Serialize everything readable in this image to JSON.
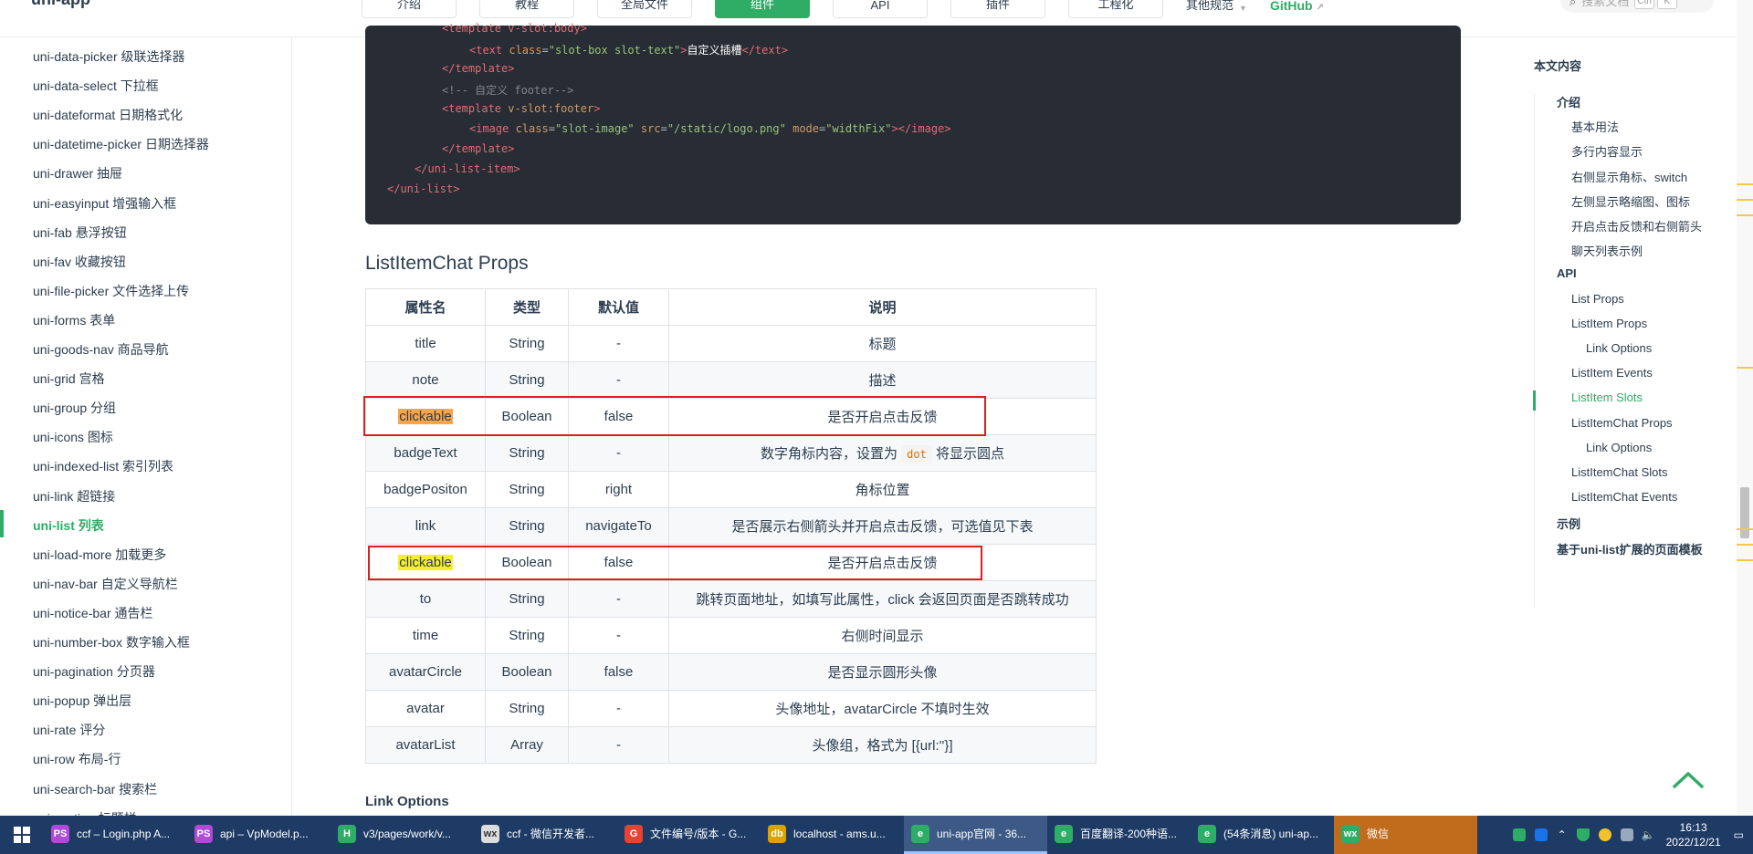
{
  "header": {
    "logo": "uni-app",
    "nav": [
      "介绍",
      "教程",
      "全局文件",
      "组件",
      "API",
      "插件",
      "工程化"
    ],
    "nav_active": "组件",
    "nav_more": "其他规范",
    "github": "GitHub",
    "search_placeholder": "搜索文档",
    "search_keys": [
      "Ctrl",
      "K"
    ]
  },
  "sidebar": {
    "items": [
      "uni-data-picker 级联选择器",
      "uni-data-select 下拉框",
      "uni-dateformat 日期格式化",
      "uni-datetime-picker 日期选择器",
      "uni-drawer 抽屉",
      "uni-easyinput 增强输入框",
      "uni-fab 悬浮按钮",
      "uni-fav 收藏按钮",
      "uni-file-picker 文件选择上传",
      "uni-forms 表单",
      "uni-goods-nav 商品导航",
      "uni-grid 宫格",
      "uni-group 分组",
      "uni-icons 图标",
      "uni-indexed-list 索引列表",
      "uni-link 超链接",
      "uni-list 列表",
      "uni-load-more 加载更多",
      "uni-nav-bar 自定义导航栏",
      "uni-notice-bar 通告栏",
      "uni-number-box 数字输入框",
      "uni-pagination 分页器",
      "uni-popup 弹出层",
      "uni-rate 评分",
      "uni-row 布局-行",
      "uni-search-bar 搜索栏",
      "uni-section 标题栏"
    ],
    "active": "uni-list 列表"
  },
  "code": {
    "line0": "<template v-slot:body>",
    "line1_open": "<text",
    "line1_attr": "class",
    "line1_val": "\"slot-box slot-text\"",
    "line1_text": "自定义插槽",
    "line1_close": "</text>",
    "line2": "</template>",
    "line3": "<!-- 自定义 footer-->",
    "line4_open": "<template",
    "line4_attr": "v-slot:footer",
    "line5_open": "<image",
    "line5_attr1": "class",
    "line5_val1": "\"slot-image\"",
    "line5_attr2": "src",
    "line5_val2": "\"/static/logo.png\"",
    "line5_attr3": "mode",
    "line5_val3": "\"widthFix\"",
    "line5_close": "</image>",
    "line6": "</template>",
    "line7": "</uni-list-item>",
    "line8": "</uni-list>"
  },
  "section_title": "ListItemChat Props",
  "table": {
    "headers": [
      "属性名",
      "类型",
      "默认值",
      "说明"
    ],
    "rows": [
      [
        "title",
        "String",
        "-",
        "标题"
      ],
      [
        "note",
        "String",
        "-",
        "描述"
      ],
      [
        "clickable",
        "Boolean",
        "false",
        "是否开启点击反馈"
      ],
      [
        "badgeText",
        "String",
        "-",
        "数字角标内容，设置为",
        "dot",
        "将显示圆点"
      ],
      [
        "badgePositon",
        "String",
        "right",
        "角标位置"
      ],
      [
        "link",
        "String",
        "navigateTo",
        "是否展示右侧箭头并开启点击反馈，可选值见下表"
      ],
      [
        "clickable",
        "Boolean",
        "false",
        "是否开启点击反馈"
      ],
      [
        "to",
        "String",
        "-",
        "跳转页面地址，如填写此属性，click 会返回页面是否跳转成功"
      ],
      [
        "time",
        "String",
        "-",
        "右侧时间显示"
      ],
      [
        "avatarCircle",
        "Boolean",
        "false",
        "是否显示圆形头像"
      ],
      [
        "avatar",
        "String",
        "-",
        "头像地址，avatarCircle 不填时生效"
      ],
      [
        "avatarList",
        "Array",
        "-",
        "头像组，格式为 [{url:''}]"
      ]
    ]
  },
  "next_heading": "Link Options",
  "toc": {
    "title": "本文内容",
    "items": [
      {
        "label": "介绍",
        "level": 1
      },
      {
        "label": "基本用法",
        "level": 2
      },
      {
        "label": "多行内容显示",
        "level": 2
      },
      {
        "label": "右侧显示角标、switch",
        "level": 2
      },
      {
        "label": "左侧显示略缩图、图标",
        "level": 2
      },
      {
        "label": "开启点击反馈和右侧箭头",
        "level": 2
      },
      {
        "label": "聊天列表示例",
        "level": 2
      },
      {
        "label": "API",
        "level": 1
      },
      {
        "label": "List Props",
        "level": 2
      },
      {
        "label": "ListItem Props",
        "level": 2
      },
      {
        "label": "Link Options",
        "level": 3
      },
      {
        "label": "ListItem Events",
        "level": 2
      },
      {
        "label": "ListItem Slots",
        "level": 2,
        "active": true
      },
      {
        "label": "ListItemChat Props",
        "level": 2
      },
      {
        "label": "Link Options",
        "level": 3
      },
      {
        "label": "ListItemChat Slots",
        "level": 2
      },
      {
        "label": "ListItemChat Events",
        "level": 2
      },
      {
        "label": "示例",
        "level": 1
      },
      {
        "label": "基于uni-list扩展的页面模板",
        "level": 1
      }
    ]
  },
  "taskbar": {
    "tasks": [
      {
        "label": "ccf – Login.php A...",
        "icon": "PS",
        "color": "#b04ad9"
      },
      {
        "label": "api – VpModel.p...",
        "icon": "PS",
        "color": "#b04ad9"
      },
      {
        "label": "v3/pages/work/v...",
        "icon": "H",
        "color": "#2fac66"
      },
      {
        "label": "ccf - 微信开发者...",
        "icon": "wx",
        "color": "#dddddd"
      },
      {
        "label": "文件编号/版本 - G...",
        "icon": "G",
        "color": "#e94235"
      },
      {
        "label": "localhost - ams.u...",
        "icon": "db",
        "color": "#d9a400"
      },
      {
        "label": "uni-app官网 - 36...",
        "icon": "e",
        "color": "#2fac66",
        "active": true
      },
      {
        "label": "百度翻译-200种语...",
        "icon": "e",
        "color": "#2fac66"
      },
      {
        "label": "(54条消息) uni-ap...",
        "icon": "e",
        "color": "#2fac66"
      },
      {
        "label": "微信",
        "icon": "wx",
        "color": "#2fac66",
        "wechat": true
      }
    ],
    "time": "16:13",
    "date": "2022/12/21"
  }
}
